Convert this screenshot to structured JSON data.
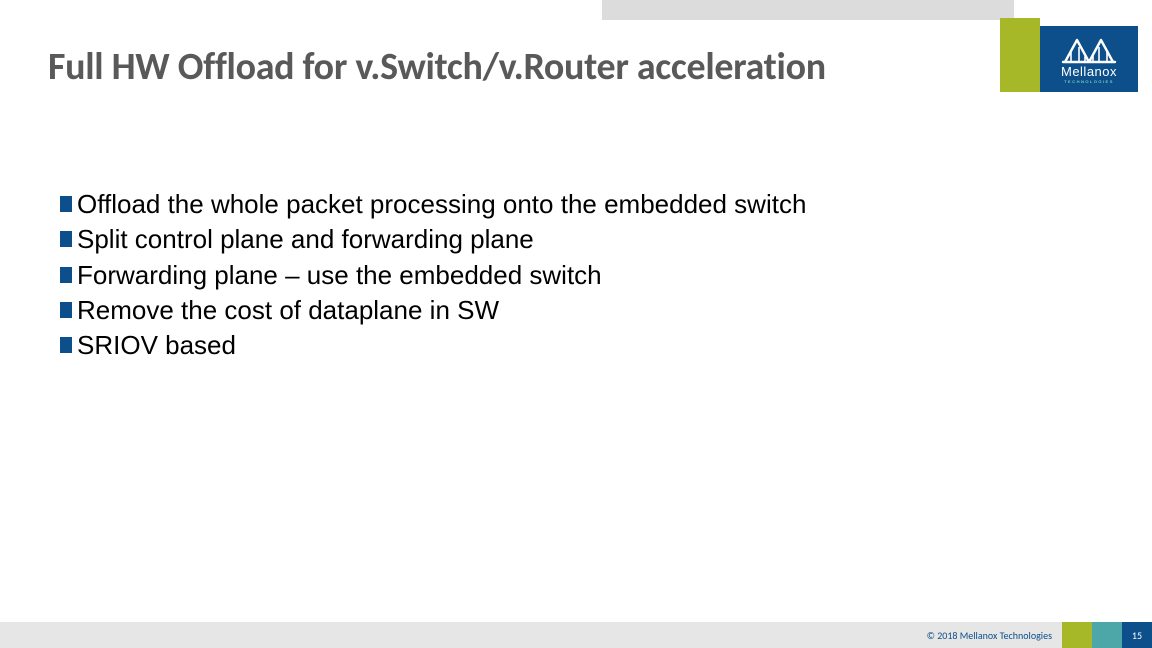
{
  "slide": {
    "title": "Full HW Offload  for v.Switch/v.Router acceleration",
    "bullets": [
      "Offload the whole packet processing onto the embedded switch",
      "Split control plane and forwarding plane",
      "Forwarding plane – use the embedded switch",
      "Remove the cost of dataplane in SW",
      "SRIOV based"
    ]
  },
  "branding": {
    "logo_name": "Mellanox",
    "logo_sub": "TECHNOLOGIES"
  },
  "footer": {
    "copyright": "© 2018 Mellanox Technologies",
    "page_number": "15"
  }
}
